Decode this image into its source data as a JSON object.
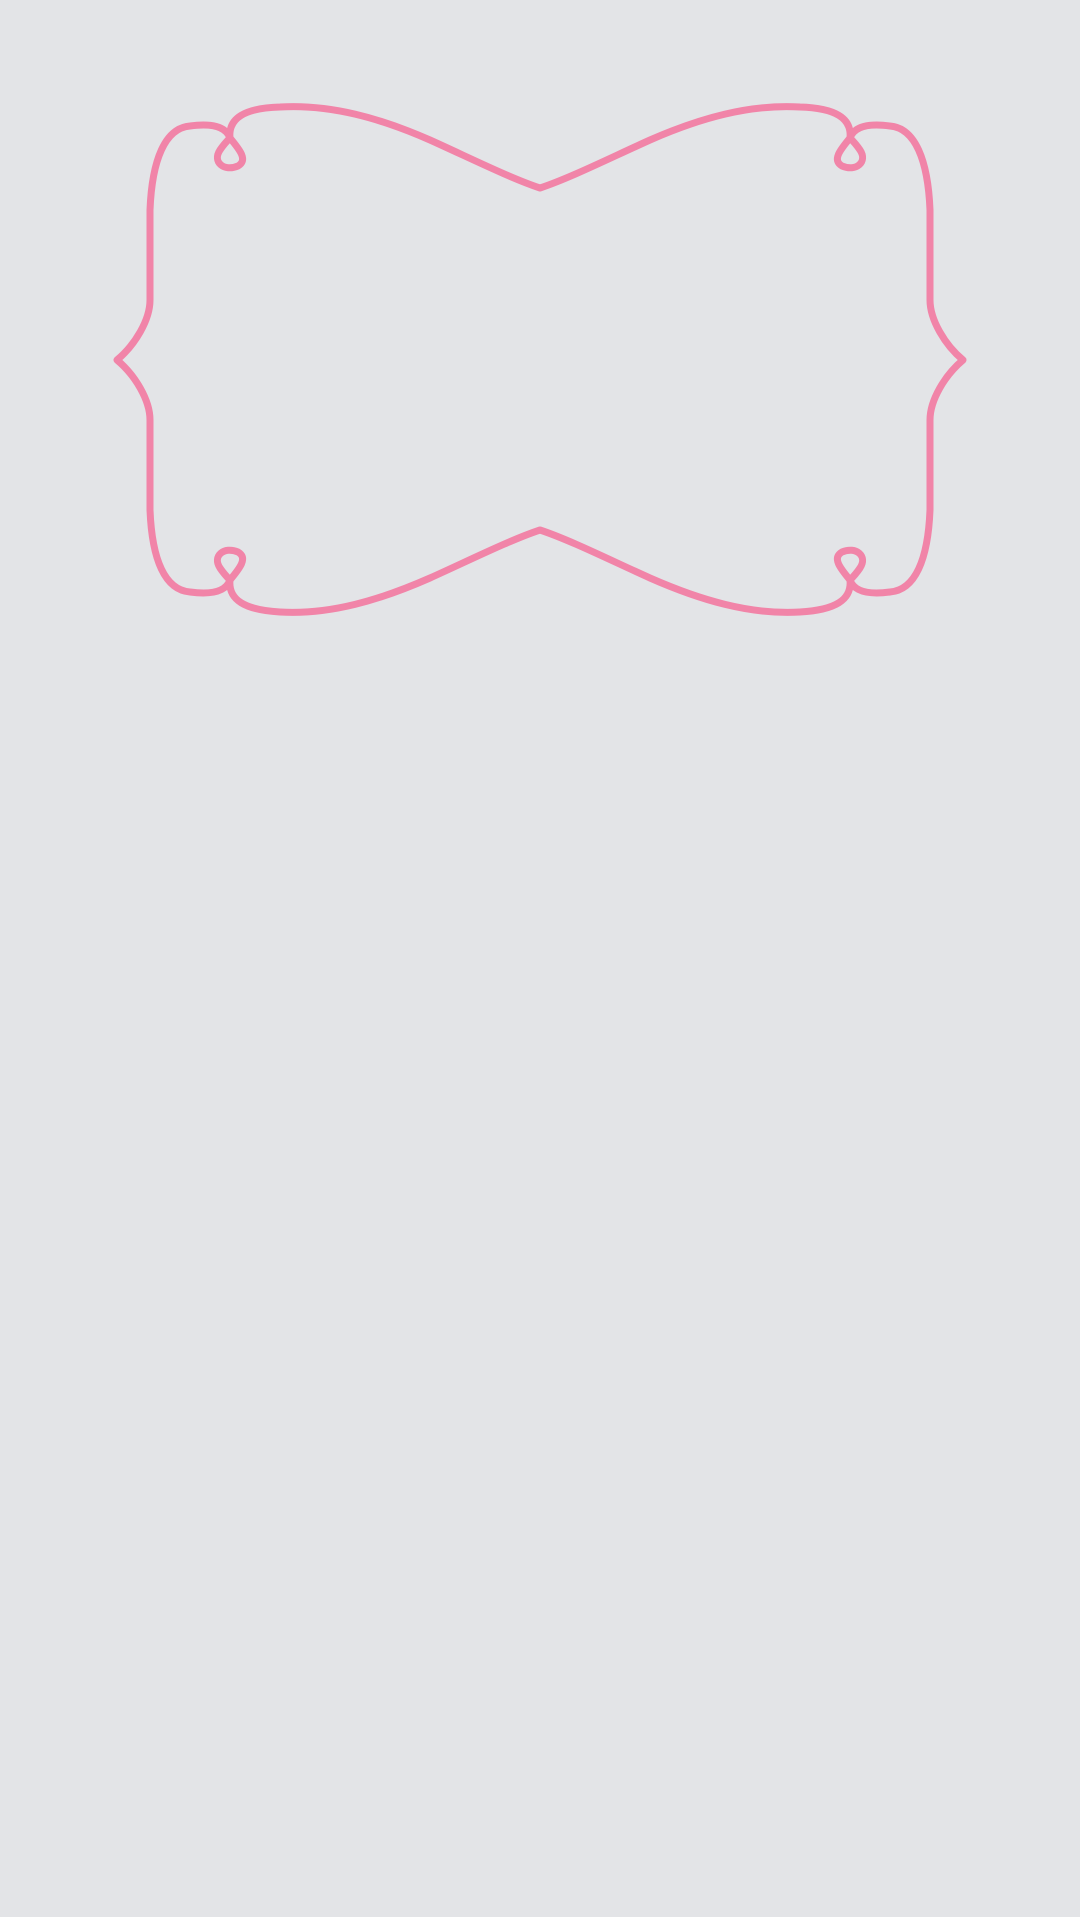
{
  "screen": {
    "background_color": "#e3e4e7"
  },
  "decorative_frame": {
    "icon": "ornate-bracket-frame-icon",
    "stroke_color": "#f184a8",
    "label": ""
  }
}
